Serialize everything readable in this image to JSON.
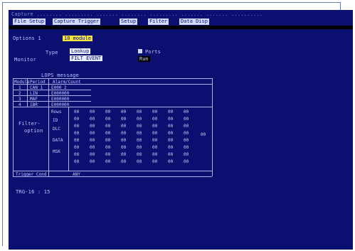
{
  "title_line": "Capture ........ ......... ....... ........ ......... ....... ....... ..........",
  "menu": [
    "File  Setup",
    "Capture   Trigger",
    "Setup",
    "Filter",
    "Data   Disp"
  ],
  "status_left": "Options   1",
  "status_highlight": "10 module",
  "type_label": "Type",
  "type_value": "Lookup",
  "monitor_label": "Monitor",
  "monitor_value": "FILT   EVENT",
  "option_label": "Ports",
  "option_value": "Run",
  "section_title": "LOPS  message",
  "table_header": [
    "Module",
    "Period",
    "Alarm/Count"
  ],
  "table_rows": [
    {
      "idx": "1",
      "name": "CAN 1",
      "value": "E000 2"
    },
    {
      "idx": "2",
      "name": "LIN",
      "value": "E000000"
    },
    {
      "idx": "3",
      "name": "MAF",
      "value": "E000000"
    },
    {
      "idx": "4",
      "name": "IBR",
      "value": "E000000"
    }
  ],
  "filter_label": "Filter-",
  "filter_label2": "option",
  "rows_label": "Rows",
  "filter_row_labels": [
    "ID",
    "DLC",
    "DATA",
    "MSK"
  ],
  "grid_values": [
    [
      "00",
      "00",
      "00",
      "00",
      "00",
      "00",
      "00",
      "00"
    ],
    [
      "00",
      "00",
      "00",
      "00",
      "00",
      "00",
      "00",
      "00"
    ],
    [
      "00",
      "00",
      "00",
      "00",
      "00",
      "00",
      "00",
      "00"
    ],
    [
      "00",
      "00",
      "00",
      "00",
      "00",
      "00",
      "00",
      "00"
    ],
    [
      "00",
      "00",
      "00",
      "00",
      "00",
      "00",
      "00",
      "00"
    ],
    [
      "00",
      "00",
      "00",
      "00",
      "00",
      "00",
      "00",
      "00"
    ],
    [
      "00",
      "00",
      "00",
      "00",
      "00",
      "00",
      "00",
      "00"
    ],
    [
      "00",
      "00",
      "00",
      "00",
      "00",
      "00",
      "00",
      "00"
    ]
  ],
  "right_cell": "00",
  "footer_row_label": "Trigger  Cond",
  "footer_row_value": "ANY",
  "bottom_status": "TRG-16 : 15",
  "colors": {
    "screen_bg": "#0b1070",
    "text": "#b9c4ff",
    "highlight": "#f2e341"
  }
}
